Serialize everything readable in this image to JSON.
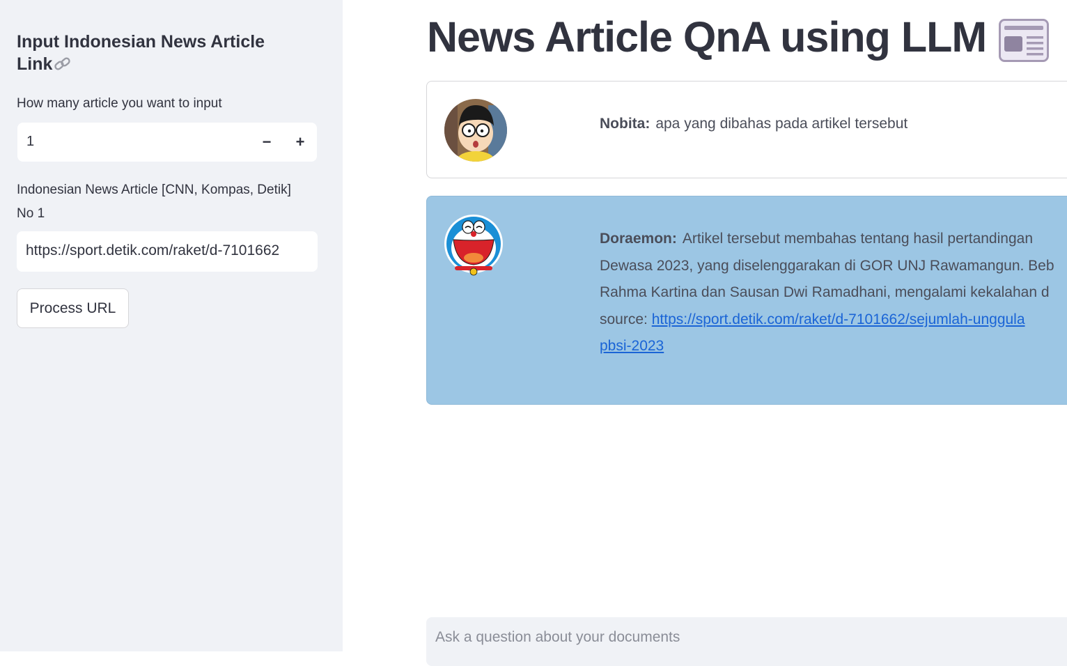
{
  "sidebar": {
    "title": "Input Indonesian News Article Link",
    "count_label": "How many article you want to input",
    "count_value": "1",
    "decrement_symbol": "−",
    "increment_symbol": "+",
    "article_label": "Indonesian News Article [CNN, Kompas, Detik]",
    "article_number_label": "No 1",
    "article_url_value": "https://sport.detik.com/raket/d-7101662",
    "process_button": "Process URL"
  },
  "main": {
    "title": "News Article QnA using LLM",
    "messages": [
      {
        "speaker": "Nobita:",
        "lines": [
          "apa yang dibahas pada artikel tersebut"
        ]
      },
      {
        "speaker": "Doraemon:",
        "lines": [
          "Artikel tersebut membahas tentang hasil pertandingan",
          "Dewasa 2023, yang diselenggarakan di GOR UNJ Rawamangun. Beb",
          "Rahma Kartina dan Sausan Dwi Ramadhani, mengalami kekalahan d"
        ],
        "source_label": "source:",
        "source_link_line1": "https://sport.detik.com/raket/d-7101662/sejumlah-unggula",
        "source_link_line2": "pbsi-2023"
      }
    ],
    "chat_placeholder": "Ask a question about your documents"
  },
  "colors": {
    "sidebar_bg": "#f0f2f6",
    "assistant_bg": "#9cc6e4",
    "link": "#1a64d6",
    "text": "#31333f"
  },
  "icons": [
    "link-icon",
    "newspaper-icon",
    "nobita-avatar",
    "doraemon-avatar"
  ]
}
